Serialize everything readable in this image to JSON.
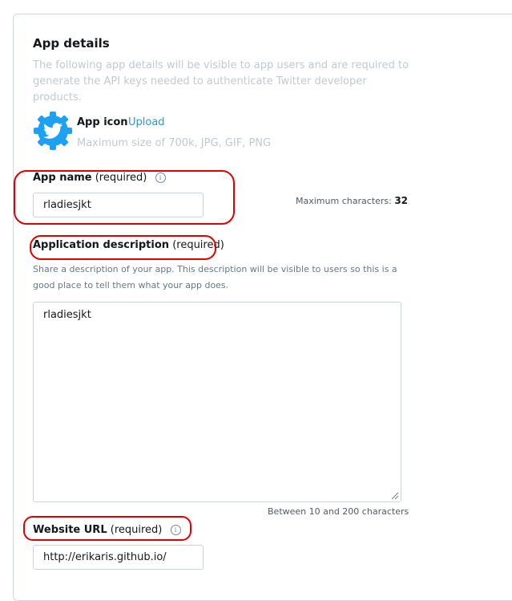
{
  "section": {
    "title": "App details",
    "subtitle": "The following app details will be visible to app users and are required to generate the API keys needed to authenticate Twitter developer products."
  },
  "app_icon": {
    "label": "App icon",
    "upload_label": "Upload",
    "hint": "Maximum size of 700k, JPG, GIF, PNG",
    "icon": "twitter-bird-gear-icon",
    "color": "#1da1f2"
  },
  "app_name": {
    "label": "App name",
    "required": "(required)",
    "value": "rladiesjkt",
    "max_label": "Maximum characters:",
    "max_value": "32"
  },
  "description": {
    "label": "Application description",
    "required": "(required)",
    "hint": "Share a description of your app. This description will be visible to users so this is a good place to tell them what your app does.",
    "value": "rladiesjkt",
    "length_hint": "Between 10 and 200 characters"
  },
  "website": {
    "label": "Website URL",
    "required": "(required)",
    "value": "http://erikaris.github.io/"
  },
  "colors": {
    "annotation": "#e00000",
    "link": "#1d9bd8",
    "muted": "#c2c9cf"
  }
}
